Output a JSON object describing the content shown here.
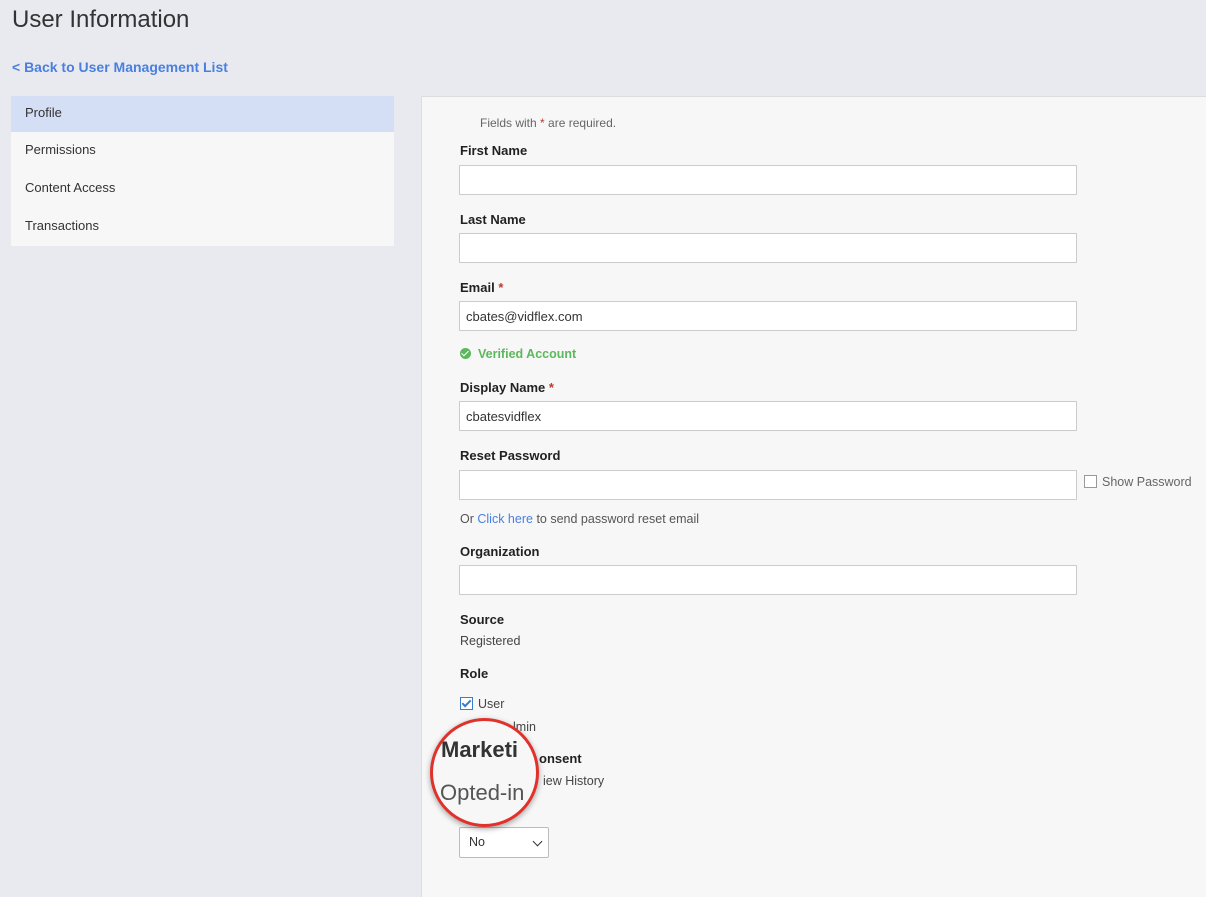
{
  "header": {
    "title": "User Information",
    "back_link": "< Back to User Management List"
  },
  "sidebar": {
    "items": [
      {
        "label": "Profile",
        "active": true
      },
      {
        "label": "Permissions"
      },
      {
        "label": "Content Access"
      },
      {
        "label": "Transactions"
      }
    ]
  },
  "form": {
    "required_note_prefix": "Fields with",
    "required_star": "*",
    "required_note_suffix": "are required.",
    "first_name": {
      "label": "First Name",
      "value": ""
    },
    "last_name": {
      "label": "Last Name",
      "value": ""
    },
    "email": {
      "label": "Email",
      "value": "cbates@vidflex.com"
    },
    "verified_text": "Verified Account",
    "display_name": {
      "label": "Display Name",
      "value": "cbatesvidflex"
    },
    "reset_password": {
      "label": "Reset Password",
      "value": "",
      "show_password_label": "Show Password"
    },
    "reset_line": {
      "prefix": "Or",
      "link": "Click here",
      "suffix": "to send password reset email"
    },
    "organization": {
      "label": "Organization",
      "value": ""
    },
    "source": {
      "label": "Source",
      "value": "Registered"
    },
    "role": {
      "label": "Role",
      "user_label": "User",
      "admin_partial": "lmin"
    },
    "marketing": {
      "label_partial": "onsent",
      "view_history_partial": "iew History"
    },
    "dropdown": {
      "selected": "No"
    }
  },
  "magnifier": {
    "top_text": "Marketi",
    "bottom_text": "Opted-in"
  },
  "colors": {
    "link": "#4a7fe0",
    "verified": "#5cb85c",
    "required": "#c0392b",
    "magnifier_ring": "#e0322b",
    "active_tab": "#d4def5"
  }
}
